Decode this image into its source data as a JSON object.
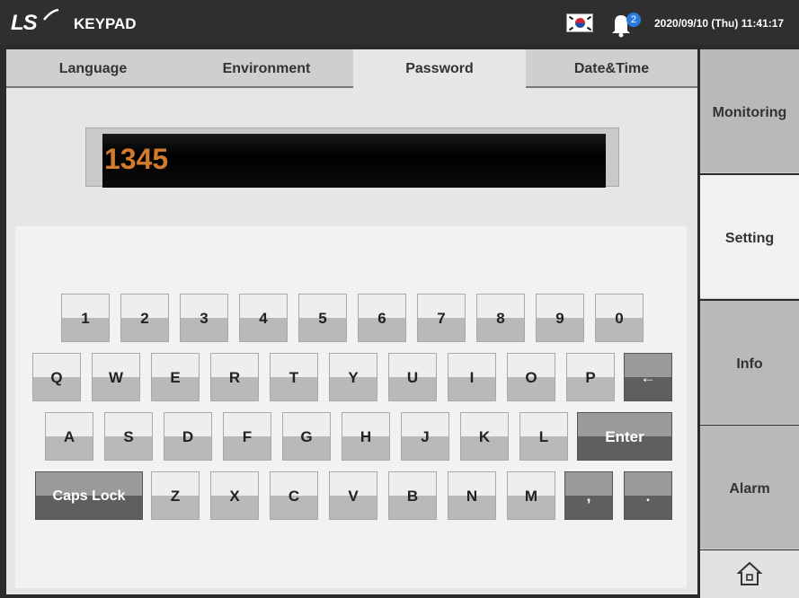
{
  "header": {
    "logo": "LS",
    "title": "KEYPAD",
    "flag_icon": "korea-flag-icon",
    "notification_count": "2",
    "datetime": "2020/09/10 (Thu) 11:41:17"
  },
  "tabs": [
    {
      "label": "Language"
    },
    {
      "label": "Environment"
    },
    {
      "label": "Password"
    },
    {
      "label": "Date&Time"
    }
  ],
  "active_tab": "Password",
  "display": {
    "value": "1345",
    "text_color": "#d17b2e"
  },
  "keyboard": {
    "row1": [
      "1",
      "2",
      "3",
      "4",
      "5",
      "6",
      "7",
      "8",
      "9",
      "0"
    ],
    "row2": [
      "Q",
      "W",
      "E",
      "R",
      "T",
      "Y",
      "U",
      "I",
      "O",
      "P"
    ],
    "backspace": "←",
    "row3": [
      "A",
      "S",
      "D",
      "F",
      "G",
      "H",
      "J",
      "K",
      "L"
    ],
    "enter": "Enter",
    "caps": "Caps Lock",
    "row4": [
      "Z",
      "X",
      "C",
      "V",
      "B",
      "N",
      "M"
    ],
    "comma": ",",
    "period": "."
  },
  "sidebar": [
    {
      "label": "Monitoring"
    },
    {
      "label": "Setting"
    },
    {
      "label": "Info"
    },
    {
      "label": "Alarm"
    }
  ],
  "active_sidebar": "Setting",
  "home_icon": "home-icon"
}
